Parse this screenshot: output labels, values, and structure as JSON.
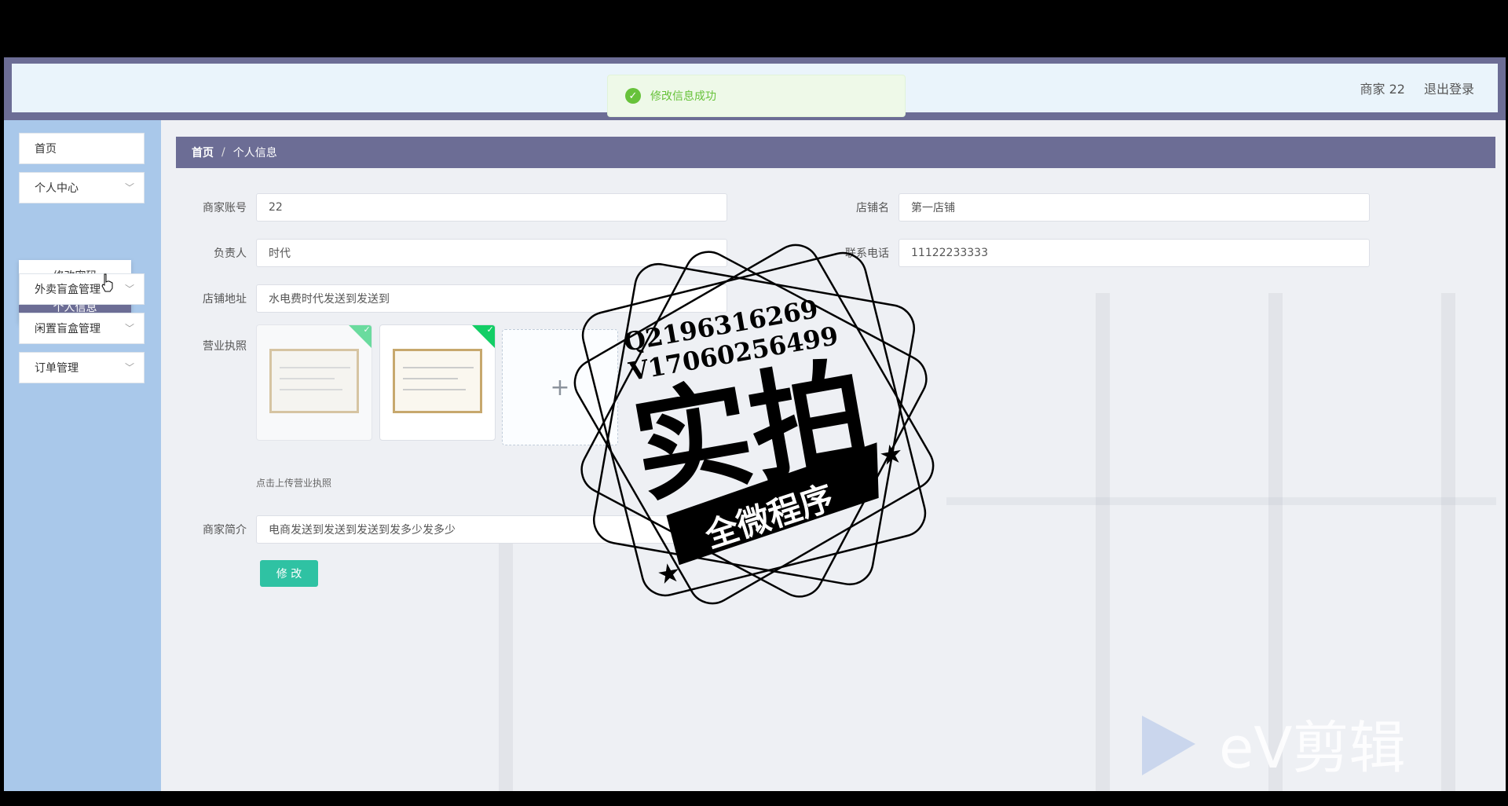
{
  "header": {
    "user_label": "商家 22",
    "logout_label": "退出登录"
  },
  "toast": {
    "message": "修改信息成功"
  },
  "sidebar": {
    "items": [
      {
        "label": "首页"
      },
      {
        "label": "个人中心"
      },
      {
        "label": "外卖盲盒管理"
      },
      {
        "label": "闲置盲盒管理"
      },
      {
        "label": "订单管理"
      }
    ],
    "submenu": [
      {
        "label": "修改密码"
      },
      {
        "label": "个人信息"
      }
    ]
  },
  "breadcrumb": {
    "home": "首页",
    "separator": "/",
    "current": "个人信息"
  },
  "form": {
    "account_label": "商家账号",
    "account_value": "22",
    "shop_name_label": "店铺名",
    "shop_name_value": "第一店铺",
    "manager_label": "负责人",
    "manager_value": "时代",
    "phone_label": "联系电话",
    "phone_value": "11122233333",
    "address_label": "店铺地址",
    "address_value": "水电费时代发送到发送到",
    "license_label": "营业执照",
    "upload_plus": "+",
    "upload_hint": "点击上传营业执照",
    "intro_label": "商家简介",
    "intro_value": "电商发送到发送到发送到发多少发多少",
    "submit_label": "修 改"
  },
  "watermark": {
    "qq": "Q2196316269",
    "vx": "V17060256499",
    "big": "实拍",
    "banner": "全微程序",
    "ev_text": "eV剪辑"
  },
  "colors": {
    "topbar": "#6c6d95",
    "sidebar": "#a9c8ea",
    "active": "#6c6d95",
    "button": "#2fc2a3",
    "success": "#67c23a"
  }
}
